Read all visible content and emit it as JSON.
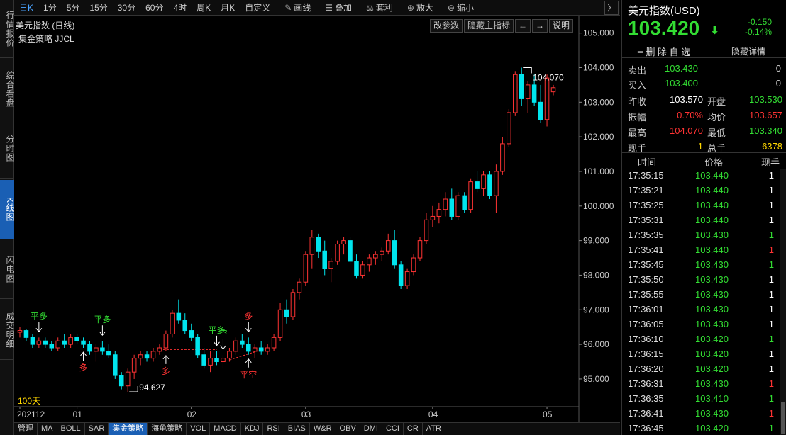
{
  "toolbar": {
    "items": [
      "日K",
      "1分",
      "5分",
      "15分",
      "30分",
      "60分",
      "4时",
      "周K",
      "月K",
      "自定义"
    ],
    "active": "日K",
    "tools": [
      {
        "icon": "pencil-icon",
        "glyph": "✎",
        "label": "画线"
      },
      {
        "icon": "layers-icon",
        "glyph": "☰",
        "label": "叠加"
      },
      {
        "icon": "arbitrage-icon",
        "glyph": "⚖",
        "label": "套利"
      },
      {
        "icon": "zoom-in-icon",
        "glyph": "⊕",
        "label": "放大"
      },
      {
        "icon": "zoom-out-icon",
        "glyph": "⊖",
        "label": "缩小"
      }
    ],
    "right_arrow": "〉"
  },
  "left_tabs": [
    "行情报价",
    "综合看盘",
    "分时图",
    "K线图",
    "闪电图",
    "成交明细"
  ],
  "left_active": "K线图",
  "chart": {
    "title": "美元指数 (日线)",
    "strategy_label": "集金策略 JJCL",
    "buttons": [
      "改参数",
      "隐藏主指标",
      "←",
      "→",
      "说明"
    ],
    "days_label": "100天",
    "high_label": "104.070",
    "low_label": "94.627",
    "signals": [
      {
        "text": "平多",
        "color": "#33dd33",
        "bar": 3,
        "pos": "above"
      },
      {
        "text": "平多",
        "color": "#33dd33",
        "bar": 13,
        "pos": "above"
      },
      {
        "text": "平多",
        "color": "#33dd33",
        "bar": 31,
        "pos": "above"
      },
      {
        "text": "多",
        "color": "#ff3333",
        "bar": 36,
        "pos": "above"
      },
      {
        "text": "多",
        "color": "#ff3333",
        "bar": 10,
        "pos": "below"
      },
      {
        "text": "多",
        "color": "#ff3333",
        "bar": 23,
        "pos": "below"
      },
      {
        "text": "空",
        "color": "#33dd33",
        "bar": 32,
        "pos": "above"
      },
      {
        "text": "平空",
        "color": "#ff3333",
        "bar": 36,
        "pos": "below"
      }
    ]
  },
  "chart_data": {
    "type": "candlestick",
    "title": "美元指数 (日线)",
    "y_ticks": [
      95.0,
      96.0,
      97.0,
      98.0,
      99.0,
      100.0,
      101.0,
      102.0,
      103.0,
      104.0,
      105.0
    ],
    "ylim": [
      94.2,
      105.3
    ],
    "x_ticks": [
      {
        "label": "202112",
        "bar": 0
      },
      {
        "label": "01",
        "bar": 9
      },
      {
        "label": "02",
        "bar": 27
      },
      {
        "label": "03",
        "bar": 45
      },
      {
        "label": "04",
        "bar": 65
      },
      {
        "label": "05",
        "bar": 83
      }
    ],
    "candles": [
      [
        96.35,
        96.5,
        96.2,
        96.4
      ],
      [
        96.4,
        96.45,
        96.1,
        96.2
      ],
      [
        96.2,
        96.3,
        95.9,
        96.0
      ],
      [
        96.0,
        96.2,
        95.9,
        96.1
      ],
      [
        96.1,
        96.2,
        95.9,
        96.0
      ],
      [
        96.0,
        96.1,
        95.8,
        95.9
      ],
      [
        95.9,
        96.2,
        95.8,
        96.1
      ],
      [
        96.1,
        96.3,
        95.9,
        96.0
      ],
      [
        96.0,
        96.3,
        95.9,
        96.2
      ],
      [
        96.2,
        96.3,
        96.0,
        96.1
      ],
      [
        96.1,
        96.2,
        95.9,
        96.0
      ],
      [
        96.0,
        96.1,
        95.7,
        95.8
      ],
      [
        95.8,
        96.0,
        95.5,
        95.9
      ],
      [
        95.9,
        96.1,
        95.7,
        95.8
      ],
      [
        95.8,
        96.0,
        95.6,
        95.7
      ],
      [
        95.7,
        95.8,
        95.0,
        95.1
      ],
      [
        95.1,
        95.2,
        94.7,
        94.8
      ],
      [
        94.8,
        95.3,
        94.63,
        95.2
      ],
      [
        95.2,
        95.7,
        95.0,
        95.6
      ],
      [
        95.6,
        95.8,
        95.4,
        95.7
      ],
      [
        95.7,
        95.8,
        95.5,
        95.6
      ],
      [
        95.6,
        95.9,
        95.5,
        95.8
      ],
      [
        95.8,
        96.0,
        95.7,
        95.9
      ],
      [
        95.9,
        96.4,
        95.8,
        96.3
      ],
      [
        96.3,
        97.0,
        96.2,
        96.9
      ],
      [
        96.9,
        97.3,
        96.6,
        96.7
      ],
      [
        96.7,
        96.9,
        96.3,
        96.4
      ],
      [
        96.4,
        96.6,
        96.1,
        96.2
      ],
      [
        96.2,
        96.3,
        95.6,
        95.7
      ],
      [
        95.7,
        95.9,
        95.3,
        95.4
      ],
      [
        95.4,
        95.8,
        95.2,
        95.6
      ],
      [
        95.6,
        95.8,
        95.4,
        95.5
      ],
      [
        95.5,
        95.7,
        95.3,
        95.6
      ],
      [
        95.6,
        95.9,
        95.5,
        95.8
      ],
      [
        95.8,
        96.2,
        95.7,
        96.1
      ],
      [
        96.1,
        96.3,
        95.9,
        96.0
      ],
      [
        96.0,
        96.2,
        95.7,
        95.8
      ],
      [
        95.8,
        96.0,
        95.6,
        95.9
      ],
      [
        95.9,
        96.1,
        95.7,
        95.8
      ],
      [
        95.8,
        96.0,
        95.7,
        95.9
      ],
      [
        95.9,
        96.3,
        95.8,
        96.2
      ],
      [
        96.2,
        97.2,
        96.1,
        97.0
      ],
      [
        97.0,
        97.3,
        96.6,
        96.8
      ],
      [
        96.8,
        97.6,
        96.7,
        97.5
      ],
      [
        97.5,
        97.9,
        97.3,
        97.8
      ],
      [
        97.8,
        98.7,
        97.7,
        98.6
      ],
      [
        98.6,
        99.3,
        98.2,
        99.1
      ],
      [
        99.1,
        99.2,
        98.5,
        98.7
      ],
      [
        98.7,
        99.0,
        98.0,
        98.2
      ],
      [
        98.2,
        98.5,
        97.8,
        98.4
      ],
      [
        98.4,
        99.0,
        98.3,
        98.9
      ],
      [
        98.9,
        99.1,
        98.6,
        99.0
      ],
      [
        99.0,
        99.1,
        98.3,
        98.4
      ],
      [
        98.4,
        98.6,
        97.9,
        98.0
      ],
      [
        98.0,
        98.4,
        97.9,
        98.3
      ],
      [
        98.3,
        98.6,
        98.1,
        98.5
      ],
      [
        98.5,
        98.7,
        98.3,
        98.6
      ],
      [
        98.6,
        98.8,
        98.4,
        98.7
      ],
      [
        98.7,
        99.2,
        98.6,
        99.0
      ],
      [
        99.0,
        99.3,
        98.2,
        98.3
      ],
      [
        98.3,
        98.4,
        97.6,
        97.7
      ],
      [
        97.7,
        98.2,
        97.6,
        98.1
      ],
      [
        98.1,
        98.6,
        98.0,
        98.5
      ],
      [
        98.5,
        99.1,
        98.4,
        99.0
      ],
      [
        99.0,
        99.8,
        98.9,
        99.6
      ],
      [
        99.6,
        100.0,
        99.4,
        99.7
      ],
      [
        99.7,
        100.1,
        99.5,
        99.9
      ],
      [
        99.9,
        100.4,
        99.7,
        100.2
      ],
      [
        100.2,
        100.5,
        99.6,
        99.7
      ],
      [
        99.7,
        100.4,
        99.6,
        100.3
      ],
      [
        100.3,
        100.4,
        99.8,
        99.9
      ],
      [
        99.9,
        100.8,
        99.8,
        100.7
      ],
      [
        100.7,
        101.0,
        100.4,
        100.5
      ],
      [
        100.5,
        101.0,
        100.3,
        100.9
      ],
      [
        100.9,
        101.0,
        100.2,
        100.3
      ],
      [
        100.3,
        101.2,
        99.8,
        101.0
      ],
      [
        101.0,
        102.0,
        100.9,
        101.8
      ],
      [
        101.8,
        102.8,
        101.7,
        102.7
      ],
      [
        102.7,
        103.9,
        102.6,
        103.8
      ],
      [
        103.8,
        104.0,
        102.9,
        103.1
      ],
      [
        103.1,
        103.6,
        102.7,
        103.5
      ],
      [
        103.5,
        103.8,
        102.9,
        103.0
      ],
      [
        103.0,
        103.5,
        102.4,
        102.5
      ],
      [
        102.5,
        103.8,
        102.3,
        103.7
      ],
      [
        103.3,
        103.5,
        103.2,
        103.42
      ]
    ]
  },
  "quote": {
    "name": "美元指数(USD)",
    "price": "103.420",
    "arrow": "⬇",
    "change": "-0.150",
    "change_pct": "-0.14%",
    "delete_label": "━ 删 除 自 选",
    "hide_label": "隐藏详情",
    "ask": {
      "label": "卖出",
      "price": "103.430",
      "qty": "0"
    },
    "bid": {
      "label": "买入",
      "price": "103.400",
      "qty": "0"
    },
    "rows": [
      [
        {
          "label": "昨收",
          "value": "103.570",
          "color": "#ffffff"
        },
        {
          "label": "开盘",
          "value": "103.530",
          "color": "#33dd33"
        }
      ],
      [
        {
          "label": "振幅",
          "value": "0.70%",
          "color": "#ff3333"
        },
        {
          "label": "均价",
          "value": "103.657",
          "color": "#ff3333"
        }
      ],
      [
        {
          "label": "最高",
          "value": "104.070",
          "color": "#ff3333"
        },
        {
          "label": "最低",
          "value": "103.340",
          "color": "#33dd33"
        }
      ],
      [
        {
          "label": "现手",
          "value": "1",
          "color": "#ffd700"
        },
        {
          "label": "总手",
          "value": "6378",
          "color": "#ffd700"
        }
      ]
    ]
  },
  "ticks": {
    "headers": [
      "时间",
      "价格",
      "现手"
    ],
    "rows": [
      {
        "time": "17:35:15",
        "price": "103.440",
        "qty": "1",
        "qty_color": "#ffffff"
      },
      {
        "time": "17:35:21",
        "price": "103.440",
        "qty": "1",
        "qty_color": "#ffffff"
      },
      {
        "time": "17:35:25",
        "price": "103.440",
        "qty": "1",
        "qty_color": "#ffffff"
      },
      {
        "time": "17:35:31",
        "price": "103.440",
        "qty": "1",
        "qty_color": "#ffffff"
      },
      {
        "time": "17:35:35",
        "price": "103.430",
        "qty": "1",
        "qty_color": "#33dd33"
      },
      {
        "time": "17:35:41",
        "price": "103.440",
        "qty": "1",
        "qty_color": "#ff3333"
      },
      {
        "time": "17:35:45",
        "price": "103.430",
        "qty": "1",
        "qty_color": "#33dd33"
      },
      {
        "time": "17:35:50",
        "price": "103.430",
        "qty": "1",
        "qty_color": "#ffffff"
      },
      {
        "time": "17:35:55",
        "price": "103.430",
        "qty": "1",
        "qty_color": "#ffffff"
      },
      {
        "time": "17:36:01",
        "price": "103.430",
        "qty": "1",
        "qty_color": "#ffffff"
      },
      {
        "time": "17:36:05",
        "price": "103.430",
        "qty": "1",
        "qty_color": "#ffffff"
      },
      {
        "time": "17:36:10",
        "price": "103.420",
        "qty": "1",
        "qty_color": "#33dd33"
      },
      {
        "time": "17:36:15",
        "price": "103.420",
        "qty": "1",
        "qty_color": "#ffffff"
      },
      {
        "time": "17:36:20",
        "price": "103.420",
        "qty": "1",
        "qty_color": "#ffffff"
      },
      {
        "time": "17:36:31",
        "price": "103.430",
        "qty": "1",
        "qty_color": "#ff3333"
      },
      {
        "time": "17:36:35",
        "price": "103.410",
        "qty": "1",
        "qty_color": "#33dd33"
      },
      {
        "time": "17:36:41",
        "price": "103.430",
        "qty": "1",
        "qty_color": "#ff3333"
      },
      {
        "time": "17:36:45",
        "price": "103.420",
        "qty": "1",
        "qty_color": "#33dd33"
      }
    ]
  },
  "bottom_tabs": [
    "管理",
    "MA",
    "BOLL",
    "SAR",
    "集金策略",
    "海龟策略",
    "VOL",
    "MACD",
    "KDJ",
    "RSI",
    "BIAS",
    "W&R",
    "OBV",
    "DMI",
    "CCI",
    "CR",
    "ATR"
  ],
  "bottom_active": "集金策略",
  "colors": {
    "up": "#ff3333",
    "down": "#00e5ee",
    "green": "#33dd33",
    "red": "#ff3333",
    "accent": "#1a5fb4"
  }
}
